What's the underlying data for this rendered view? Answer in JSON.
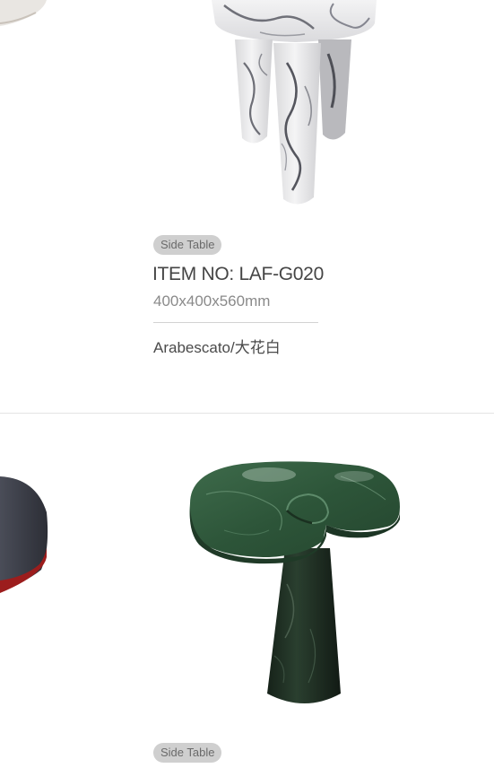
{
  "products": [
    {
      "image_alt": "Marble stool with three cylindrical legs",
      "tag": "Side Table",
      "item_no": "ITEM NO:   LAF-G020",
      "size": "400x400x560mm",
      "material": "Arabescato/大花白",
      "colors": {
        "marble": "#efeff0",
        "veins": "#7a7a80"
      }
    },
    {
      "image_alt": "Green marble side table with spiral top and conical base",
      "tag": "Side Table",
      "colors": {
        "marble": "#2f5a3c",
        "base": "#1f2f24"
      }
    }
  ],
  "colors": {
    "tag_bg": "#cfcfcf",
    "text_dark": "#454545",
    "text_muted": "#8a8a8a",
    "divider": "#e4e4e4"
  }
}
